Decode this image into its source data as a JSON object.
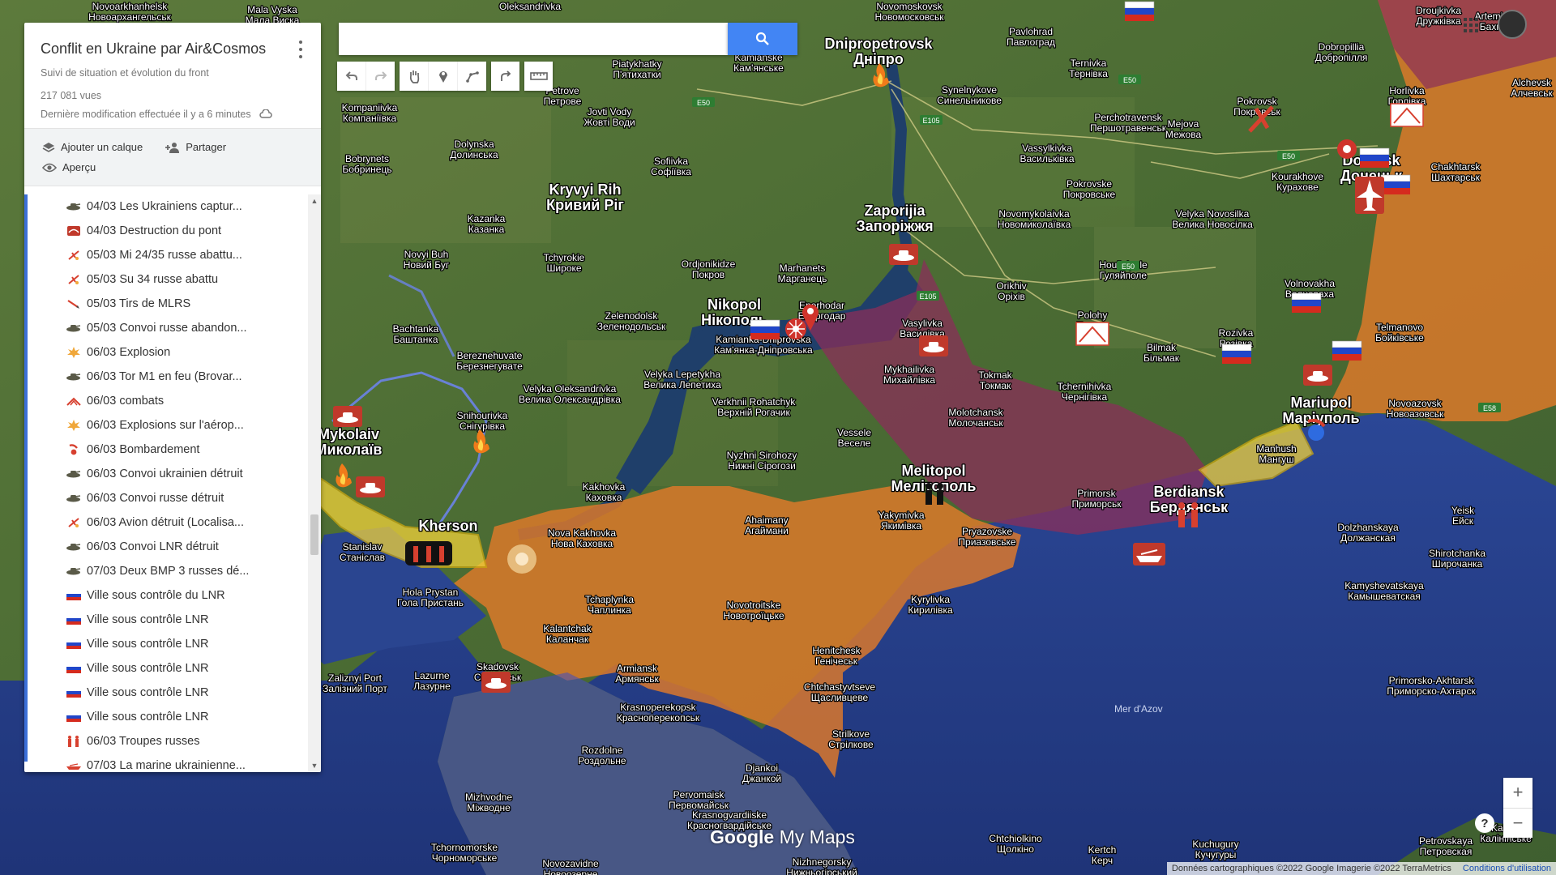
{
  "panel": {
    "title": "Conflit en Ukraine par Air&Cosmos",
    "subtitle": "Suivi de situation et évolution du front",
    "views": "217 081 vues",
    "last_modified": "Dernière modification effectuée il y a 6 minutes",
    "actions": {
      "add_layer": "Ajouter un calque",
      "share": "Partager",
      "preview": "Aperçu"
    }
  },
  "layer_items": [
    {
      "label": "04/03 Les Ukrainiens captur...",
      "icon": "tank-icon"
    },
    {
      "label": "04/03 Destruction du pont",
      "icon": "bridge-icon"
    },
    {
      "label": "05/03 Mi 24/35 russe abattu...",
      "icon": "downed-aircraft-icon"
    },
    {
      "label": "05/03 Su 34 russe abattu",
      "icon": "downed-aircraft-icon"
    },
    {
      "label": "05/03 Tirs de MLRS",
      "icon": "rocket-icon"
    },
    {
      "label": "05/03 Convoi russe abandon...",
      "icon": "tank-icon"
    },
    {
      "label": "06/03 Explosion",
      "icon": "explosion-icon"
    },
    {
      "label": "06/03 Tor M1 en feu (Brovar...",
      "icon": "tank-icon"
    },
    {
      "label": "06/03 combats",
      "icon": "combat-icon"
    },
    {
      "label": "06/03 Explosions sur l'aérop...",
      "icon": "explosion-icon"
    },
    {
      "label": "06/03 Bombardement",
      "icon": "bombing-icon"
    },
    {
      "label": "06/03 Convoi ukrainien détruit",
      "icon": "tank-icon"
    },
    {
      "label": "06/03 Convoi russe détruit",
      "icon": "tank-icon"
    },
    {
      "label": "06/03 Avion détruit (Localisa...",
      "icon": "downed-aircraft-icon"
    },
    {
      "label": "06/03 Convoi LNR détruit",
      "icon": "tank-icon"
    },
    {
      "label": "07/03 Deux BMP 3 russes dé...",
      "icon": "tank-icon"
    },
    {
      "label": "Ville sous contrôle du LNR",
      "icon": "russia-flag-icon"
    },
    {
      "label": "Ville sous contrôle LNR",
      "icon": "russia-flag-icon"
    },
    {
      "label": "Ville sous contrôle LNR",
      "icon": "russia-flag-icon"
    },
    {
      "label": "Ville sous contrôle LNR",
      "icon": "russia-flag-icon"
    },
    {
      "label": "Ville sous contrôle LNR",
      "icon": "russia-flag-icon"
    },
    {
      "label": "Ville sous contrôle LNR",
      "icon": "russia-flag-icon"
    },
    {
      "label": "06/03 Troupes russes",
      "icon": "troops-icon"
    },
    {
      "label": "07/03 La marine ukrainienne...",
      "icon": "ship-icon"
    }
  ],
  "search": {
    "value": "",
    "placeholder": ""
  },
  "toolbar": {
    "tools": [
      "undo-icon",
      "redo-icon",
      "hand-icon",
      "marker-icon",
      "draw-line-icon",
      "route-icon",
      "ruler-icon"
    ]
  },
  "map": {
    "sea_label": "Mer d'Azov",
    "logo": {
      "google": "Google",
      "suffix": " My Maps"
    },
    "attribution": "Données cartographiques ©2022 Google Imagerie ©2022 TerraMetrics",
    "terms": "Conditions d'utilisation",
    "zoom_in": "+",
    "zoom_out": "−",
    "help": "?",
    "colors": {
      "occupied": "#e07a2a",
      "contested": "#8a2f5a",
      "sea": "#2f4fa8",
      "land": "#4a6a35",
      "advance": "#f0d13a"
    },
    "cities": [
      {
        "name": "Dnipropetrovsk",
        "alt": "Дніпро",
        "big": true
      },
      {
        "name": "Zaporijia",
        "alt": "Запоріжжя",
        "big": true
      },
      {
        "name": "Kryvyi Rih",
        "alt": "Кривий Ріг",
        "big": true
      },
      {
        "name": "Nikopol",
        "alt": "Нікополь",
        "big": true
      },
      {
        "name": "Melitopol",
        "alt": "Мелітополь",
        "big": true
      },
      {
        "name": "Berdiansk",
        "alt": "Бердянськ",
        "big": true
      },
      {
        "name": "Mariupol",
        "alt": "Маріуполь",
        "big": true
      },
      {
        "name": "Donetsk",
        "alt": "Донецьк",
        "big": true
      },
      {
        "name": "Kherson",
        "alt": "",
        "big": true
      },
      {
        "name": "Mykolaiv",
        "alt": "Миколаїв",
        "big": true
      },
      {
        "name": "Pavlohrad",
        "alt": "Павлоград",
        "big": false
      },
      {
        "name": "Horlivka",
        "alt": "Горлівка",
        "big": false
      },
      {
        "name": "Pokrovsk",
        "alt": "Покровськ",
        "big": false
      },
      {
        "name": "Volnovakha",
        "alt": "Волноваха",
        "big": false
      },
      {
        "name": "Tokmak",
        "alt": "Токмак",
        "big": false
      },
      {
        "name": "Polohy",
        "alt": "Пологи",
        "big": false
      },
      {
        "name": "Kakhovka",
        "alt": "Каховка",
        "big": false
      },
      {
        "name": "Nova Kakhovka",
        "alt": "Нова Каховка",
        "big": false
      },
      {
        "name": "Vasylivka",
        "alt": "Василівка",
        "big": false
      },
      {
        "name": "Marhanets",
        "alt": "Марганець",
        "big": false
      },
      {
        "name": "Enerhodar",
        "alt": "Енергодар",
        "big": false
      },
      {
        "name": "Kamianka-Dniprovska",
        "alt": "Кам'янка-Дніпровська",
        "big": false
      },
      {
        "name": "Mykhailivka",
        "alt": "Михайлівка",
        "big": false
      },
      {
        "name": "Molotchansk",
        "alt": "Молочанськ",
        "big": false
      },
      {
        "name": "Vessele",
        "alt": "Веселе",
        "big": false
      },
      {
        "name": "Yakymivka",
        "alt": "Якимівка",
        "big": false
      },
      {
        "name": "Pryazovske",
        "alt": "Приазовське",
        "big": false
      },
      {
        "name": "Primorsk",
        "alt": "Приморськ",
        "big": false
      },
      {
        "name": "Skadovsk",
        "alt": "Скадовськ",
        "big": false
      },
      {
        "name": "Armiansk",
        "alt": "Армянськ",
        "big": false
      },
      {
        "name": "Krasnoperekopsk",
        "alt": "Красноперекопськ",
        "big": false
      },
      {
        "name": "Henitchesk",
        "alt": "Генічеськ",
        "big": false
      },
      {
        "name": "Chtchastyvtseve",
        "alt": "Щасливцеве",
        "big": false
      },
      {
        "name": "Strilkove",
        "alt": "Стрілкове",
        "big": false
      },
      {
        "name": "Kyrylivka",
        "alt": "Кирилівка",
        "big": false
      },
      {
        "name": "Novotroitske",
        "alt": "Новотроїцьке",
        "big": false
      },
      {
        "name": "Tchaplynka",
        "alt": "Чаплинка",
        "big": false
      },
      {
        "name": "Kalantchak",
        "alt": "Каланчак",
        "big": false
      },
      {
        "name": "Hola Prystan",
        "alt": "Гола Пристань",
        "big": false
      },
      {
        "name": "Lazurne",
        "alt": "Лазурне",
        "big": false
      },
      {
        "name": "Zaliznyi Port",
        "alt": "Залізний Порт",
        "big": false
      },
      {
        "name": "Stanislav",
        "alt": "Станіслав",
        "big": false
      },
      {
        "name": "Snihourivka",
        "alt": "Снігурівка",
        "big": false
      },
      {
        "name": "Velyka Oleksandrivka",
        "alt": "Велика Олександрівка",
        "big": false
      },
      {
        "name": "Velyka Lepetykha",
        "alt": "Велика Лепетиха",
        "big": false
      },
      {
        "name": "Verkhnii Rohatchyk",
        "alt": "Верхній Рогачик",
        "big": false
      },
      {
        "name": "Nyzhni Sirohozy",
        "alt": "Нижні Сірогози",
        "big": false
      },
      {
        "name": "Ahaimany",
        "alt": "Агаймани",
        "big": false
      },
      {
        "name": "Bachtanka",
        "alt": "Баштанка",
        "big": false
      },
      {
        "name": "Bereznehuvate",
        "alt": "Березнегувате",
        "big": false
      },
      {
        "name": "Novyi Buh",
        "alt": "Новий Буг",
        "big": false
      },
      {
        "name": "Tchyrokie",
        "alt": "Широке",
        "big": false
      },
      {
        "name": "Zelenodolsk",
        "alt": "Зеленодольськ",
        "big": false
      },
      {
        "name": "Ordjonikidze",
        "alt": "Покров",
        "big": false
      },
      {
        "name": "Kazanka",
        "alt": "Казанка",
        "big": false
      },
      {
        "name": "Dolynska",
        "alt": "Долинська",
        "big": false
      },
      {
        "name": "Bobrynets",
        "alt": "Бобринець",
        "big": false
      },
      {
        "name": "Kompaniivka",
        "alt": "Компаніївка",
        "big": false
      },
      {
        "name": "Piatykhatky",
        "alt": "П'ятихатки",
        "big": false
      },
      {
        "name": "Kamianske",
        "alt": "Кам'янське",
        "big": false
      },
      {
        "name": "Jovti Vody",
        "alt": "Жовті Води",
        "big": false
      },
      {
        "name": "Petrove",
        "alt": "Петрове",
        "big": false
      },
      {
        "name": "Sofiivka",
        "alt": "Софіївка",
        "big": false
      },
      {
        "name": "Novomoskovsk",
        "alt": "Новомосковськ",
        "big": false
      },
      {
        "name": "Synelnykove",
        "alt": "Синельникове",
        "big": false
      },
      {
        "name": "Ternivka",
        "alt": "Тернівка",
        "big": false
      },
      {
        "name": "Perchotravensk",
        "alt": "Першотравенськ",
        "big": false
      },
      {
        "name": "Vassylkivka",
        "alt": "Васильківка",
        "big": false
      },
      {
        "name": "Pokrovske",
        "alt": "Покровське",
        "big": false
      },
      {
        "name": "Mejova",
        "alt": "Межова",
        "big": false
      },
      {
        "name": "Kourakhove",
        "alt": "Курахове",
        "big": false
      },
      {
        "name": "Velyka Novosilka",
        "alt": "Велика Новосілка",
        "big": false
      },
      {
        "name": "Novomykolaivka",
        "alt": "Новомиколаївка",
        "big": false
      },
      {
        "name": "Houliaipole",
        "alt": "Гуляйполе",
        "big": false
      },
      {
        "name": "Orikhiv",
        "alt": "Оріхів",
        "big": false
      },
      {
        "name": "Bilmak",
        "alt": "Більмак",
        "big": false
      },
      {
        "name": "Rozivka",
        "alt": "Розівка",
        "big": false
      },
      {
        "name": "Tchernihivka",
        "alt": "Чернігівка",
        "big": false
      },
      {
        "name": "Telmanovo",
        "alt": "Бойківське",
        "big": false
      },
      {
        "name": "Novoazovsk",
        "alt": "Новоазовськ",
        "big": false
      },
      {
        "name": "Manhush",
        "alt": "Мангуш",
        "big": false
      },
      {
        "name": "Dolzhanskaya",
        "alt": "Должанская",
        "big": false
      },
      {
        "name": "Yeisk",
        "alt": "Ейск",
        "big": false
      },
      {
        "name": "Shirotchanka",
        "alt": "Широчанка",
        "big": false
      },
      {
        "name": "Kamyshevatskaya",
        "alt": "Камышеватская",
        "big": false
      },
      {
        "name": "Primorsko-Akhtarsk",
        "alt": "Приморско-Ахтарск",
        "big": false
      },
      {
        "name": "Chtchiolkino",
        "alt": "Щолкіно",
        "big": false
      },
      {
        "name": "Kertch",
        "alt": "Керч",
        "big": false
      },
      {
        "name": "Kuchugury",
        "alt": "Кучугуры",
        "big": false
      },
      {
        "name": "Petrovskaya",
        "alt": "Петровская",
        "big": false
      },
      {
        "name": "Rozdolne",
        "alt": "Роздольне",
        "big": false
      },
      {
        "name": "Djankoi",
        "alt": "Джанкой",
        "big": false
      },
      {
        "name": "Pervomaisk",
        "alt": "Первомайськ",
        "big": false
      },
      {
        "name": "Krasnogvardiiske",
        "alt": "Красногвардійське",
        "big": false
      },
      {
        "name": "Mizhvodne",
        "alt": "Міжводне",
        "big": false
      },
      {
        "name": "Tchornomorske",
        "alt": "Чорноморське",
        "big": false
      },
      {
        "name": "Novozavidne",
        "alt": "Новоозерне",
        "big": false
      },
      {
        "name": "Nizhnegorsky",
        "alt": "Нижньогірський",
        "big": false
      },
      {
        "name": "Oleksandrivka",
        "alt": "",
        "big": false
      },
      {
        "name": "Novoarkhanhelsk",
        "alt": "Новоархангельськ",
        "big": false
      },
      {
        "name": "Mala Vyska",
        "alt": "Мала Виска",
        "big": false
      },
      {
        "name": "Droujkivka",
        "alt": "Дружківка",
        "big": false
      },
      {
        "name": "Artemivsk",
        "alt": "Бахмут",
        "big": false
      },
      {
        "name": "Dobropillia",
        "alt": "Добропілля",
        "big": false
      },
      {
        "name": "Alchevsk",
        "alt": "Алчевськ",
        "big": false
      },
      {
        "name": "Chakhtarsk",
        "alt": "Шахтарськ",
        "big": false
      },
      {
        "name": "Kalinin",
        "alt": "Калінінське",
        "big": false
      }
    ],
    "roads": [
      "E50",
      "E50",
      "E50",
      "E105",
      "E105",
      "E58",
      "E50"
    ]
  }
}
